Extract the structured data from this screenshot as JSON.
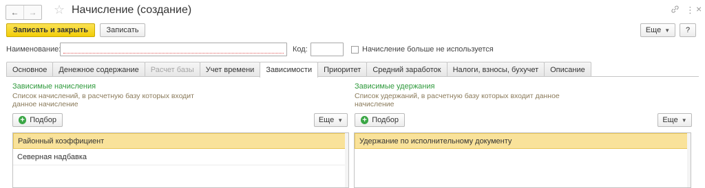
{
  "window": {
    "title": "Начисление (создание)",
    "nav_back": "←",
    "nav_forward": "→",
    "star": "☆",
    "link_icon": "🔗",
    "more_icon": "⋮",
    "close_icon": "×"
  },
  "toolbar": {
    "save_close_label": "Записать и закрыть",
    "save_label": "Записать",
    "more_label": "Еще",
    "help_label": "?"
  },
  "form": {
    "name_label": "Наименование:",
    "name_value": "",
    "code_label": "Код:",
    "code_value": "",
    "unused_label": "Начисление больше не используется",
    "unused_checked": false
  },
  "tabs": [
    {
      "label": "Основное",
      "state": "normal"
    },
    {
      "label": "Денежное содержание",
      "state": "normal"
    },
    {
      "label": "Расчет базы",
      "state": "disabled"
    },
    {
      "label": "Учет времени",
      "state": "normal"
    },
    {
      "label": "Зависимости",
      "state": "active"
    },
    {
      "label": "Приоритет",
      "state": "normal"
    },
    {
      "label": "Средний заработок",
      "state": "normal"
    },
    {
      "label": "Налоги, взносы, бухучет",
      "state": "normal"
    },
    {
      "label": "Описание",
      "state": "normal"
    }
  ],
  "left_panel": {
    "title": "Зависимые начисления",
    "description": "Список начислений, в расчетную базу которых входит данное начисление",
    "pick_label": "Подбор",
    "more_label": "Еще",
    "items": [
      "Районный коэффициент",
      "Северная надбавка"
    ]
  },
  "right_panel": {
    "title": "Зависимые удержания",
    "description": "Список удержаний, в расчетную базу которых входит данное начисление",
    "pick_label": "Подбор",
    "more_label": "Еще",
    "items": [
      "Удержание по исполнительному документу"
    ]
  },
  "colors": {
    "primary_button": "#f2cd08",
    "section_title": "#2f9a3c",
    "selected_row": "#f9e29a"
  }
}
